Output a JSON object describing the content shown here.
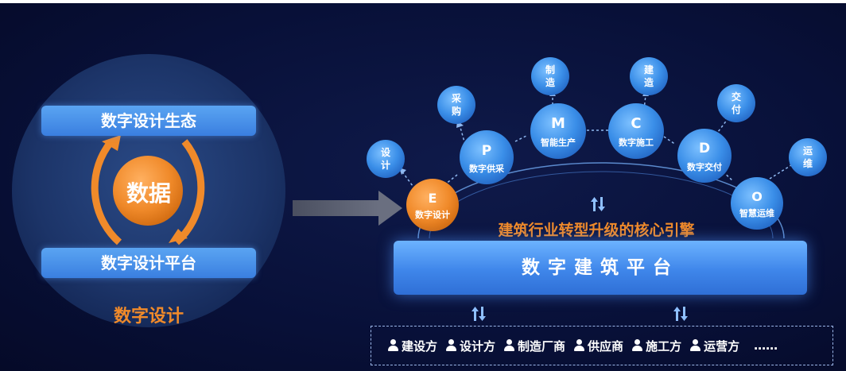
{
  "left": {
    "top_bar": "数字设计生态",
    "center": "数据",
    "bottom_bar": "数字设计平台",
    "caption": "数字设计"
  },
  "right": {
    "headline": "建筑行业转型升级的核心引擎",
    "platform": "数字建筑平台",
    "phases": [
      {
        "letter": "E",
        "label": "数字设计",
        "color": "#f08a2a"
      },
      {
        "letter": "P",
        "label": "数字供采",
        "color": "#3a8ee8"
      },
      {
        "letter": "M",
        "label": "智能生产",
        "color": "#3a8ee8"
      },
      {
        "letter": "C",
        "label": "数字施工",
        "color": "#3a8ee8"
      },
      {
        "letter": "D",
        "label": "数字交付",
        "color": "#3a8ee8"
      },
      {
        "letter": "O",
        "label": "智慧运维",
        "color": "#3a8ee8"
      }
    ],
    "outer": [
      {
        "chars": [
          "设",
          "计"
        ]
      },
      {
        "chars": [
          "采",
          "购"
        ]
      },
      {
        "chars": [
          "制",
          "造"
        ]
      },
      {
        "chars": [
          "建",
          "造"
        ]
      },
      {
        "chars": [
          "交",
          "付"
        ]
      },
      {
        "chars": [
          "运",
          "维"
        ]
      }
    ],
    "stakeholders": [
      "建设方",
      "设计方",
      "制造厂商",
      "供应商",
      "施工方",
      "运营方"
    ],
    "more": "……"
  },
  "colors": {
    "orange": "#f08a2a",
    "blue": "#3a8ee8",
    "light_blue": "#5aa4f2"
  }
}
